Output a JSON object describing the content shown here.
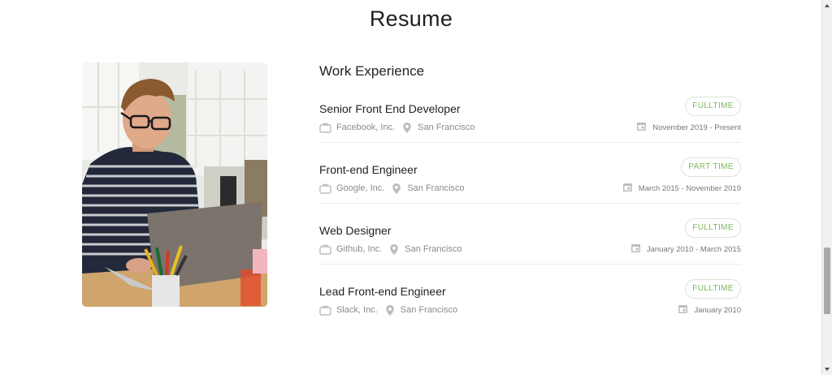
{
  "page": {
    "title": "Resume"
  },
  "section": {
    "title": "Work Experience"
  },
  "jobs": [
    {
      "title": "Senior Front End Developer",
      "type": "FULLTIME",
      "company": "Facebook, Inc.",
      "location": "San Francisco",
      "dates": "November 2019 - Present"
    },
    {
      "title": "Front-end Engineer",
      "type": "PART TIME",
      "company": "Google, Inc.",
      "location": "San Francisco",
      "dates": "March 2015 - November 2019"
    },
    {
      "title": "Web Designer",
      "type": "FULLTIME",
      "company": "Github, Inc.",
      "location": "San Francisco",
      "dates": "January 2010 - March 2015"
    },
    {
      "title": "Lead Front-end Engineer",
      "type": "FULLTIME",
      "company": "Slack, Inc.",
      "location": "San Francisco",
      "dates": "January 2010"
    }
  ],
  "colors": {
    "badge_text": "#7cb85f",
    "badge_border": "#d8e6d0",
    "meta_text": "#8a8a8a"
  },
  "icons": {
    "company": "briefcase-icon",
    "location": "map-pin-icon",
    "date": "calendar-icon"
  }
}
